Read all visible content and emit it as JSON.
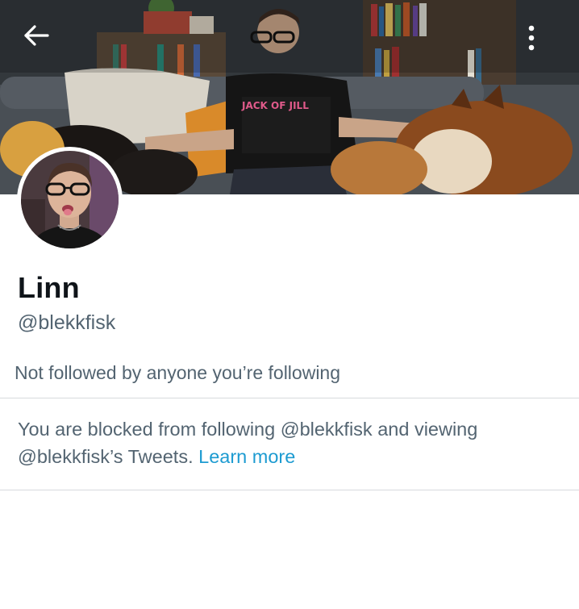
{
  "header": {
    "back_icon": "arrow-left-icon",
    "more_icon": "more-vertical-icon"
  },
  "profile": {
    "display_name": "Linn",
    "handle": "@blekkfisk",
    "follow_context": "Not followed by anyone you’re following"
  },
  "blocked_notice": {
    "text": "You are blocked from following @blekkfisk and viewing @blekkfisk’s Tweets.",
    "link_label": "Learn more"
  },
  "colors": {
    "primary_text": "#0f1419",
    "secondary_text": "#536471",
    "link": "#1d9bd1",
    "divider": "#d6dadd"
  }
}
